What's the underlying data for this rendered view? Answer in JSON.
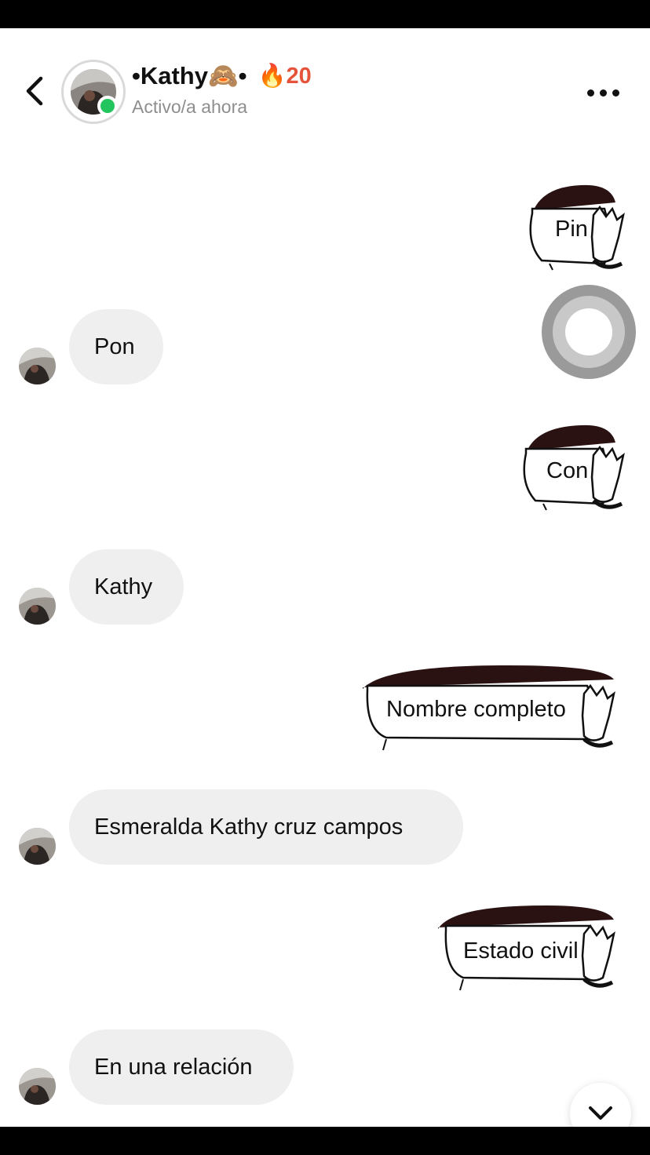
{
  "header": {
    "contact_name": "•Kathy🙈•",
    "streak_count": "🔥20",
    "status": "Activo/a ahora",
    "icons": {
      "back": "chevron-left-icon",
      "more": "more-horizontal-icon",
      "online": "online-dot-icon"
    }
  },
  "messages": [
    {
      "direction": "out",
      "type": "sticker",
      "text": "Pin"
    },
    {
      "direction": "in",
      "type": "text",
      "text": "Pon"
    },
    {
      "direction": "out",
      "type": "sticker",
      "text": "Con"
    },
    {
      "direction": "in",
      "type": "text",
      "text": "Kathy"
    },
    {
      "direction": "out",
      "type": "sticker",
      "text": "Nombre completo"
    },
    {
      "direction": "in",
      "type": "text",
      "text": "Esmeralda Kathy cruz campos"
    },
    {
      "direction": "out",
      "type": "sticker",
      "text": "Estado civil"
    },
    {
      "direction": "in",
      "type": "text",
      "text": "En una relación"
    }
  ],
  "scroll_button": {
    "icon": "chevron-down-icon"
  },
  "colors": {
    "online": "#22c55e",
    "streak": "#e5533b",
    "bubble_in": "#efefef",
    "status_text": "#8e8e8e"
  }
}
